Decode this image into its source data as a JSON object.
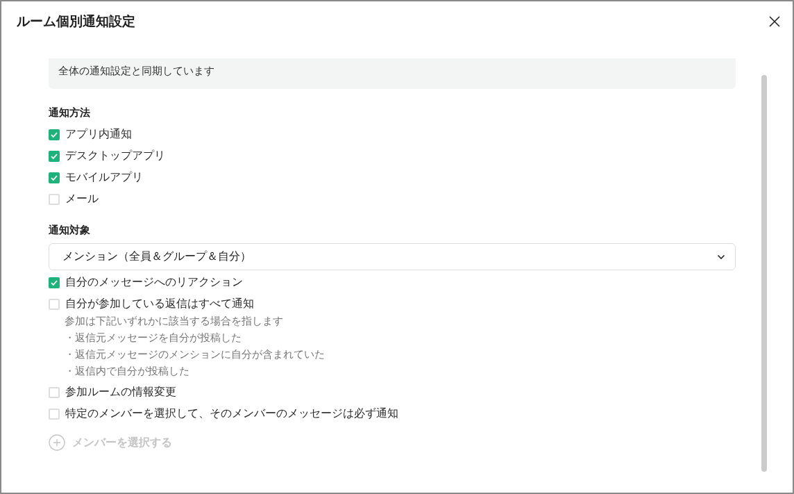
{
  "dialog": {
    "title": "ルーム個別通知設定"
  },
  "sync_banner": "全体の通知設定と同期しています",
  "methods": {
    "heading": "通知方法",
    "options": [
      {
        "label": "アプリ内通知",
        "checked": true
      },
      {
        "label": "デスクトップアプリ",
        "checked": true
      },
      {
        "label": "モバイルアプリ",
        "checked": true
      },
      {
        "label": "メール",
        "checked": false
      }
    ]
  },
  "targets": {
    "heading": "通知対象",
    "select": {
      "value": "メンション（全員＆グループ＆自分）"
    },
    "options": [
      {
        "label": "自分のメッセージへのリアクション",
        "checked": true
      },
      {
        "label": "自分が参加している返信はすべて通知",
        "checked": false,
        "note": "参加は下記いずれかに該当する場合を指します",
        "bullets": [
          "・返信元メッセージを自分が投稿した",
          "・返信元メッセージのメンションに自分が含まれていた",
          "・返信内で自分が投稿した"
        ]
      },
      {
        "label": "参加ルームの情報変更",
        "checked": false
      },
      {
        "label": "特定のメンバーを選択して、そのメンバーのメッセージは必ず通知",
        "checked": false
      }
    ]
  },
  "add_member": {
    "label": "メンバーを選択する",
    "disabled": true
  }
}
